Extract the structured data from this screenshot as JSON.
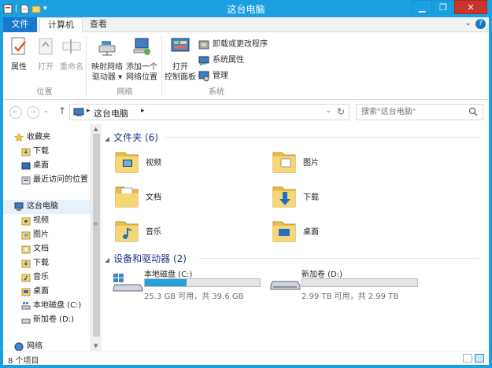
{
  "window": {
    "title": "这台电脑"
  },
  "titlebar": {
    "minimize": "▁",
    "restore": "❐",
    "close": "✕"
  },
  "ribbon": {
    "tabs": [
      {
        "label": "文件"
      },
      {
        "label": "计算机"
      },
      {
        "label": "查看"
      }
    ],
    "help": "?",
    "groups": {
      "location": {
        "label": "位置",
        "buttons": [
          {
            "label": "属性"
          },
          {
            "label": "打开"
          },
          {
            "label": "重命名"
          }
        ]
      },
      "network": {
        "label": "网络",
        "buttons": [
          {
            "line1": "映射网络",
            "line2": "驱动器 ▾"
          },
          {
            "line1": "添加一个",
            "line2": "网络位置"
          }
        ]
      },
      "system": {
        "label": "系统",
        "open": {
          "line1": "打开",
          "line2": "控制面板"
        },
        "small": [
          {
            "label": "卸载或更改程序"
          },
          {
            "label": "系统属性"
          },
          {
            "label": "管理"
          }
        ]
      }
    }
  },
  "address": {
    "back": "←",
    "forward": "→",
    "up": "↑",
    "crumb": "这台电脑",
    "search_placeholder": "搜索\"这台电脑\""
  },
  "nav": {
    "favorites": {
      "label": "收藏夹",
      "items": [
        {
          "label": "下载"
        },
        {
          "label": "桌面"
        },
        {
          "label": "最近访问的位置"
        }
      ]
    },
    "thispc": {
      "label": "这台电脑",
      "items": [
        {
          "label": "视频"
        },
        {
          "label": "图片"
        },
        {
          "label": "文档"
        },
        {
          "label": "下载"
        },
        {
          "label": "音乐"
        },
        {
          "label": "桌面"
        },
        {
          "label": "本地磁盘 (C:)"
        },
        {
          "label": "新加卷 (D:)"
        }
      ]
    },
    "network": {
      "label": "网络"
    }
  },
  "content": {
    "folders_header": "文件夹 (6)",
    "folders": [
      {
        "name": "视频"
      },
      {
        "name": "图片"
      },
      {
        "name": "文档"
      },
      {
        "name": "下载"
      },
      {
        "name": "音乐"
      },
      {
        "name": "桌面"
      }
    ],
    "drives_header": "设备和驱动器 (2)",
    "drives": [
      {
        "name": "本地磁盘 (C:)",
        "info": "25.3 GB 可用，共 39.6 GB",
        "used_fraction": 0.36
      },
      {
        "name": "新加卷 (D:)",
        "info": "2.99 TB 可用，共 2.99 TB",
        "used_fraction": 0.0
      }
    ]
  },
  "status": {
    "count": "8 个项目"
  },
  "colors": {
    "accent": "#1ba1e2",
    "file_tab": "#1979ca",
    "header_text": "#1e3287",
    "usage_bar": "#26a0da"
  }
}
